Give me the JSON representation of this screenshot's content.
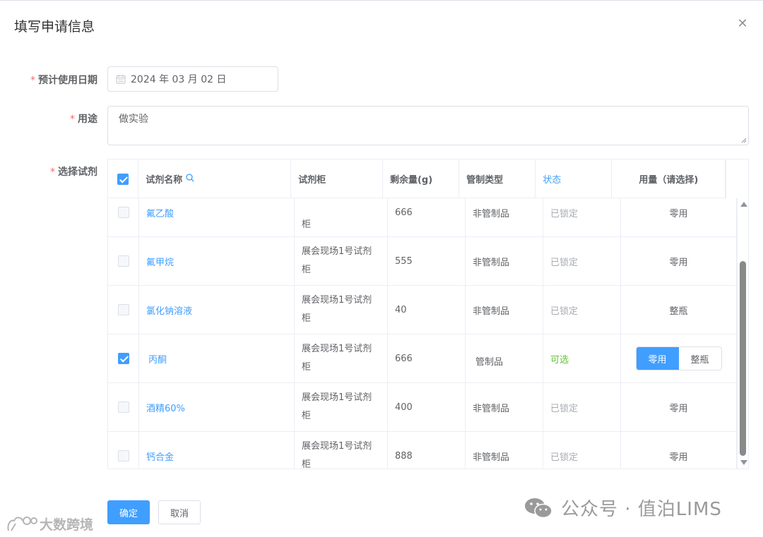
{
  "dialog": {
    "title": "填写申请信息",
    "close_glyph": "✕"
  },
  "form": {
    "date_label": "预计使用日期",
    "date_value": "2024 年 03 月 02 日",
    "purpose_label": "用途",
    "purpose_value": "做实验",
    "reagent_label": "选择试剂",
    "required_mark": "*"
  },
  "table": {
    "headers": {
      "name": "试剂名称",
      "cabinet": "试剂柜",
      "remaining": "剩余量(g)",
      "control": "管制类型",
      "status": "状态",
      "usage": "用量（请选择)"
    },
    "header_checked": true,
    "rows": [
      {
        "name": "氟乙酸",
        "cabinet": "柜",
        "remaining": "666",
        "control": "非管制品",
        "status": "已锁定",
        "usage": "零用",
        "checked": false
      },
      {
        "name": "氟甲烷",
        "cabinet": "展会现场1号试剂柜",
        "remaining": "555",
        "control": "非管制品",
        "status": "已锁定",
        "usage": "零用",
        "checked": false
      },
      {
        "name": "氯化钠溶液",
        "cabinet": "展会现场1号试剂柜",
        "remaining": "40",
        "control": "非管制品",
        "status": "已锁定",
        "usage": "整瓶",
        "checked": false
      },
      {
        "name": "丙酮",
        "cabinet": "展会现场1号试剂柜",
        "remaining": "666",
        "control": "管制品",
        "status": "可选",
        "usage_options": [
          "零用",
          "整瓶"
        ],
        "usage_selected": "零用",
        "checked": true
      },
      {
        "name": "酒精60%",
        "cabinet": "展会现场1号试剂柜",
        "remaining": "400",
        "control": "非管制品",
        "status": "已锁定",
        "usage": "零用",
        "checked": false
      },
      {
        "name": "钙合金",
        "cabinet": "展会现场1号试剂柜",
        "remaining": "888",
        "control": "非管制品",
        "status": "已锁定",
        "usage": "零用",
        "checked": false
      }
    ]
  },
  "buttons": {
    "confirm": "确定",
    "cancel": "取消"
  },
  "watermarks": {
    "right": "公众号 · 值泊LIMS",
    "left": "大数跨境"
  },
  "colors": {
    "primary": "#409eff",
    "success": "#67c23a",
    "danger": "#f56c6c",
    "locked": "#a8abb2"
  }
}
